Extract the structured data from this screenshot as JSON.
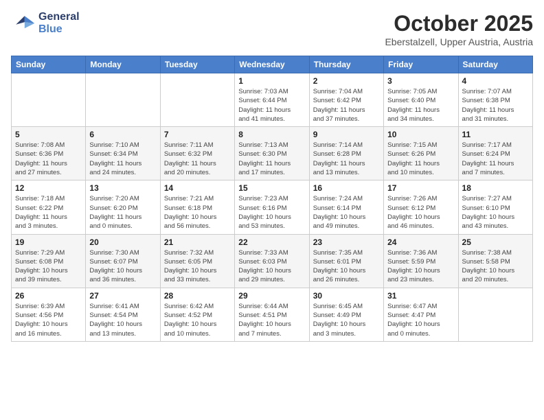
{
  "header": {
    "logo_line1": "General",
    "logo_line2": "Blue",
    "month": "October 2025",
    "location": "Eberstalzell, Upper Austria, Austria"
  },
  "weekdays": [
    "Sunday",
    "Monday",
    "Tuesday",
    "Wednesday",
    "Thursday",
    "Friday",
    "Saturday"
  ],
  "weeks": [
    [
      {
        "day": "",
        "info": ""
      },
      {
        "day": "",
        "info": ""
      },
      {
        "day": "",
        "info": ""
      },
      {
        "day": "1",
        "info": "Sunrise: 7:03 AM\nSunset: 6:44 PM\nDaylight: 11 hours\nand 41 minutes."
      },
      {
        "day": "2",
        "info": "Sunrise: 7:04 AM\nSunset: 6:42 PM\nDaylight: 11 hours\nand 37 minutes."
      },
      {
        "day": "3",
        "info": "Sunrise: 7:05 AM\nSunset: 6:40 PM\nDaylight: 11 hours\nand 34 minutes."
      },
      {
        "day": "4",
        "info": "Sunrise: 7:07 AM\nSunset: 6:38 PM\nDaylight: 11 hours\nand 31 minutes."
      }
    ],
    [
      {
        "day": "5",
        "info": "Sunrise: 7:08 AM\nSunset: 6:36 PM\nDaylight: 11 hours\nand 27 minutes."
      },
      {
        "day": "6",
        "info": "Sunrise: 7:10 AM\nSunset: 6:34 PM\nDaylight: 11 hours\nand 24 minutes."
      },
      {
        "day": "7",
        "info": "Sunrise: 7:11 AM\nSunset: 6:32 PM\nDaylight: 11 hours\nand 20 minutes."
      },
      {
        "day": "8",
        "info": "Sunrise: 7:13 AM\nSunset: 6:30 PM\nDaylight: 11 hours\nand 17 minutes."
      },
      {
        "day": "9",
        "info": "Sunrise: 7:14 AM\nSunset: 6:28 PM\nDaylight: 11 hours\nand 13 minutes."
      },
      {
        "day": "10",
        "info": "Sunrise: 7:15 AM\nSunset: 6:26 PM\nDaylight: 11 hours\nand 10 minutes."
      },
      {
        "day": "11",
        "info": "Sunrise: 7:17 AM\nSunset: 6:24 PM\nDaylight: 11 hours\nand 7 minutes."
      }
    ],
    [
      {
        "day": "12",
        "info": "Sunrise: 7:18 AM\nSunset: 6:22 PM\nDaylight: 11 hours\nand 3 minutes."
      },
      {
        "day": "13",
        "info": "Sunrise: 7:20 AM\nSunset: 6:20 PM\nDaylight: 11 hours\nand 0 minutes."
      },
      {
        "day": "14",
        "info": "Sunrise: 7:21 AM\nSunset: 6:18 PM\nDaylight: 10 hours\nand 56 minutes."
      },
      {
        "day": "15",
        "info": "Sunrise: 7:23 AM\nSunset: 6:16 PM\nDaylight: 10 hours\nand 53 minutes."
      },
      {
        "day": "16",
        "info": "Sunrise: 7:24 AM\nSunset: 6:14 PM\nDaylight: 10 hours\nand 49 minutes."
      },
      {
        "day": "17",
        "info": "Sunrise: 7:26 AM\nSunset: 6:12 PM\nDaylight: 10 hours\nand 46 minutes."
      },
      {
        "day": "18",
        "info": "Sunrise: 7:27 AM\nSunset: 6:10 PM\nDaylight: 10 hours\nand 43 minutes."
      }
    ],
    [
      {
        "day": "19",
        "info": "Sunrise: 7:29 AM\nSunset: 6:08 PM\nDaylight: 10 hours\nand 39 minutes."
      },
      {
        "day": "20",
        "info": "Sunrise: 7:30 AM\nSunset: 6:07 PM\nDaylight: 10 hours\nand 36 minutes."
      },
      {
        "day": "21",
        "info": "Sunrise: 7:32 AM\nSunset: 6:05 PM\nDaylight: 10 hours\nand 33 minutes."
      },
      {
        "day": "22",
        "info": "Sunrise: 7:33 AM\nSunset: 6:03 PM\nDaylight: 10 hours\nand 29 minutes."
      },
      {
        "day": "23",
        "info": "Sunrise: 7:35 AM\nSunset: 6:01 PM\nDaylight: 10 hours\nand 26 minutes."
      },
      {
        "day": "24",
        "info": "Sunrise: 7:36 AM\nSunset: 5:59 PM\nDaylight: 10 hours\nand 23 minutes."
      },
      {
        "day": "25",
        "info": "Sunrise: 7:38 AM\nSunset: 5:58 PM\nDaylight: 10 hours\nand 20 minutes."
      }
    ],
    [
      {
        "day": "26",
        "info": "Sunrise: 6:39 AM\nSunset: 4:56 PM\nDaylight: 10 hours\nand 16 minutes."
      },
      {
        "day": "27",
        "info": "Sunrise: 6:41 AM\nSunset: 4:54 PM\nDaylight: 10 hours\nand 13 minutes."
      },
      {
        "day": "28",
        "info": "Sunrise: 6:42 AM\nSunset: 4:52 PM\nDaylight: 10 hours\nand 10 minutes."
      },
      {
        "day": "29",
        "info": "Sunrise: 6:44 AM\nSunset: 4:51 PM\nDaylight: 10 hours\nand 7 minutes."
      },
      {
        "day": "30",
        "info": "Sunrise: 6:45 AM\nSunset: 4:49 PM\nDaylight: 10 hours\nand 3 minutes."
      },
      {
        "day": "31",
        "info": "Sunrise: 6:47 AM\nSunset: 4:47 PM\nDaylight: 10 hours\nand 0 minutes."
      },
      {
        "day": "",
        "info": ""
      }
    ]
  ]
}
